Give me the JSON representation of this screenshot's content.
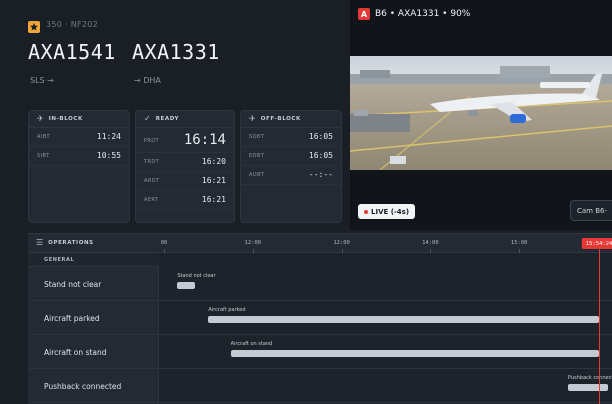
{
  "header": {
    "status_text": "350 · NF202",
    "flight_arrival": "AXA1541",
    "flight_departure": "AXA1331",
    "route_from": "SLS →",
    "route_to": "→ DHA"
  },
  "cards": {
    "in_block": {
      "title": "IN-BLOCK",
      "rows": [
        {
          "label": "AIBT",
          "value": "11:24"
        },
        {
          "label": "SIBT",
          "value": "10:55"
        }
      ]
    },
    "ready": {
      "title": "READY",
      "rows": [
        {
          "label": "PRDT",
          "value": "16:14"
        },
        {
          "label": "TRDT",
          "value": "16:20"
        },
        {
          "label": "ARDT",
          "value": "16:21"
        },
        {
          "label": "AERT",
          "value": "16:21"
        }
      ]
    },
    "off_block": {
      "title": "OFF-BLOCK",
      "rows": [
        {
          "label": "SOBT",
          "value": "16:05"
        },
        {
          "label": "EOBT",
          "value": "16:05"
        },
        {
          "label": "AOBT",
          "value": "--:--"
        }
      ]
    }
  },
  "camera": {
    "badge": "A",
    "title": "B6 • AXA1331 • 90%",
    "live_text": "LIVE (-4s)",
    "tab_text": "Cam B6-"
  },
  "operations": {
    "title": "OPERATIONS",
    "group_label": "GENERAL",
    "ticks": [
      {
        "label": "00",
        "pos": 0.0
      },
      {
        "label": "12:00",
        "pos": 0.2
      },
      {
        "label": "12:00",
        "pos": 0.4
      },
      {
        "label": "14:00",
        "pos": 0.6
      },
      {
        "label": "15:00",
        "pos": 0.8
      }
    ],
    "now_label": "15:54:24",
    "now_pos": 0.98,
    "rows": [
      {
        "label": "Stand not clear",
        "bar_label": "Stand not clear",
        "start": 0.03,
        "end": 0.07
      },
      {
        "label": "Aircraft parked",
        "bar_label": "Aircraft parked",
        "start": 0.1,
        "end": 0.98
      },
      {
        "label": "Aircraft on stand",
        "bar_label": "Aircraft on stand",
        "start": 0.15,
        "end": 0.98
      },
      {
        "label": "Pushback connected",
        "bar_label": "Pushback connected",
        "start": 0.91,
        "end": 1.0
      }
    ]
  },
  "colors": {
    "accent_red": "#e53935",
    "star": "#f0a63a",
    "bar": "#c3cad2"
  }
}
